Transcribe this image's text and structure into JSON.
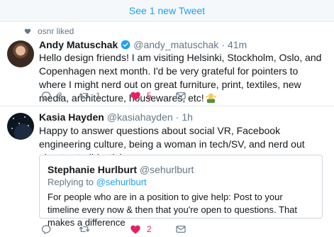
{
  "banner": {
    "label": "See 1 new Tweet"
  },
  "tweets": [
    {
      "context": "osnr liked",
      "name": "Andy Matuschak",
      "verified": true,
      "handle": "@andy_matuschak",
      "separator": "·",
      "time": "41m",
      "text": "Hello design friends! I am visiting Helsinki, Stockholm, Oslo, and Copenhagen next month. I'd be very grateful for pointers to where I might nerd out on great furniture, print, textiles, new media, architecture, housewares, etc!",
      "emoji": "person-shrugging-emoji",
      "actions": {
        "replies": "3",
        "retweets": "1",
        "likes": "5"
      }
    },
    {
      "name": "Kasia Hayden",
      "handle": "@kasiahayden",
      "separator": "·",
      "time": "1h",
      "text": "Happy to answer questions about social VR, Facebook engineering culture, being a woman in tech/SV, and nerd out about autodidacticism.",
      "quote": {
        "name": "Stephanie Hurlburt",
        "handle": "@sehurlburt",
        "replying_prefix": "Replying to ",
        "replying_handle": "@sehurlburt",
        "text": "For people who are in a position to give help: Post to your timeline every now & then that you're open to questions. That makes a difference"
      },
      "actions": {
        "replies": "",
        "retweets": "",
        "likes": "2"
      }
    }
  ],
  "colors": {
    "accent": "#1da1f2",
    "like": "#e0245e",
    "muted": "#657786",
    "border": "#e6ecf0"
  }
}
